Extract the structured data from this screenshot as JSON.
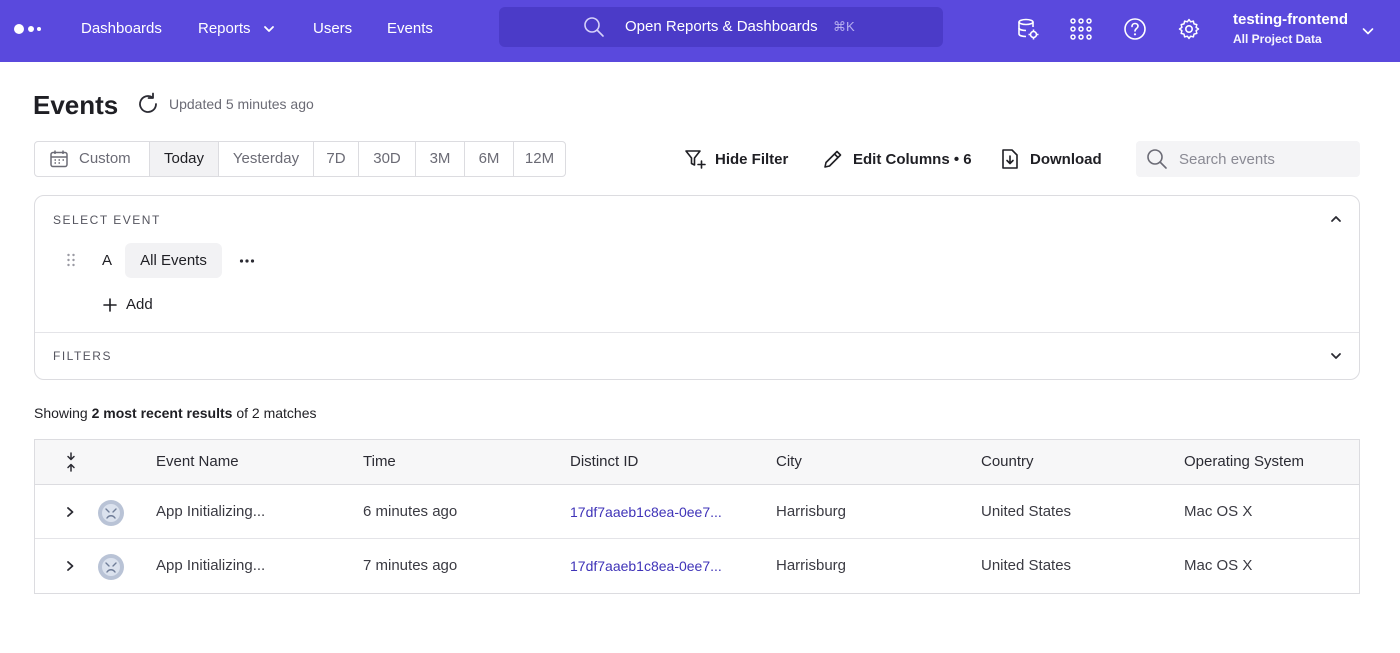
{
  "nav": {
    "items": [
      "Dashboards",
      "Reports",
      "Users",
      "Events"
    ],
    "command_bar": {
      "label": "Open Reports & Dashboards",
      "shortcut": "⌘K"
    },
    "icons": [
      "data-management-icon",
      "apps-grid-icon",
      "help-icon",
      "settings-icon"
    ],
    "project": {
      "name": "testing-frontend",
      "scope": "All Project Data"
    }
  },
  "header": {
    "title": "Events",
    "updated": "Updated 5 minutes ago"
  },
  "range": {
    "options": [
      "Custom",
      "Today",
      "Yesterday",
      "7D",
      "30D",
      "3M",
      "6M",
      "12M"
    ],
    "selected": "Today"
  },
  "toolbar": {
    "hide_filter": "Hide Filter",
    "edit_columns": "Edit Columns • 6",
    "download": "Download",
    "search_placeholder": "Search events"
  },
  "query": {
    "select_event_label": "SELECT EVENT",
    "event_letter": "A",
    "event_name": "All Events",
    "add_label": "Add",
    "filters_label": "FILTERS"
  },
  "results": {
    "prefix": "Showing ",
    "bold": "2 most recent results",
    "suffix": " of 2 matches"
  },
  "table": {
    "columns": [
      "Event Name",
      "Time",
      "Distinct ID",
      "City",
      "Country",
      "Operating System"
    ],
    "rows": [
      {
        "event": "App Initializing...",
        "time": "6 minutes ago",
        "distinct_id": "17df7aaeb1c8ea-0ee7...",
        "city": "Harrisburg",
        "country": "United States",
        "os": "Mac OS X"
      },
      {
        "event": "App Initializing...",
        "time": "7 minutes ago",
        "distinct_id": "17df7aaeb1c8ea-0ee7...",
        "city": "Harrisburg",
        "country": "United States",
        "os": "Mac OS X"
      }
    ]
  },
  "colors": {
    "nav_bg": "#5a49dd",
    "command_bg": "#4b3bc8",
    "link": "#3f33b8"
  }
}
